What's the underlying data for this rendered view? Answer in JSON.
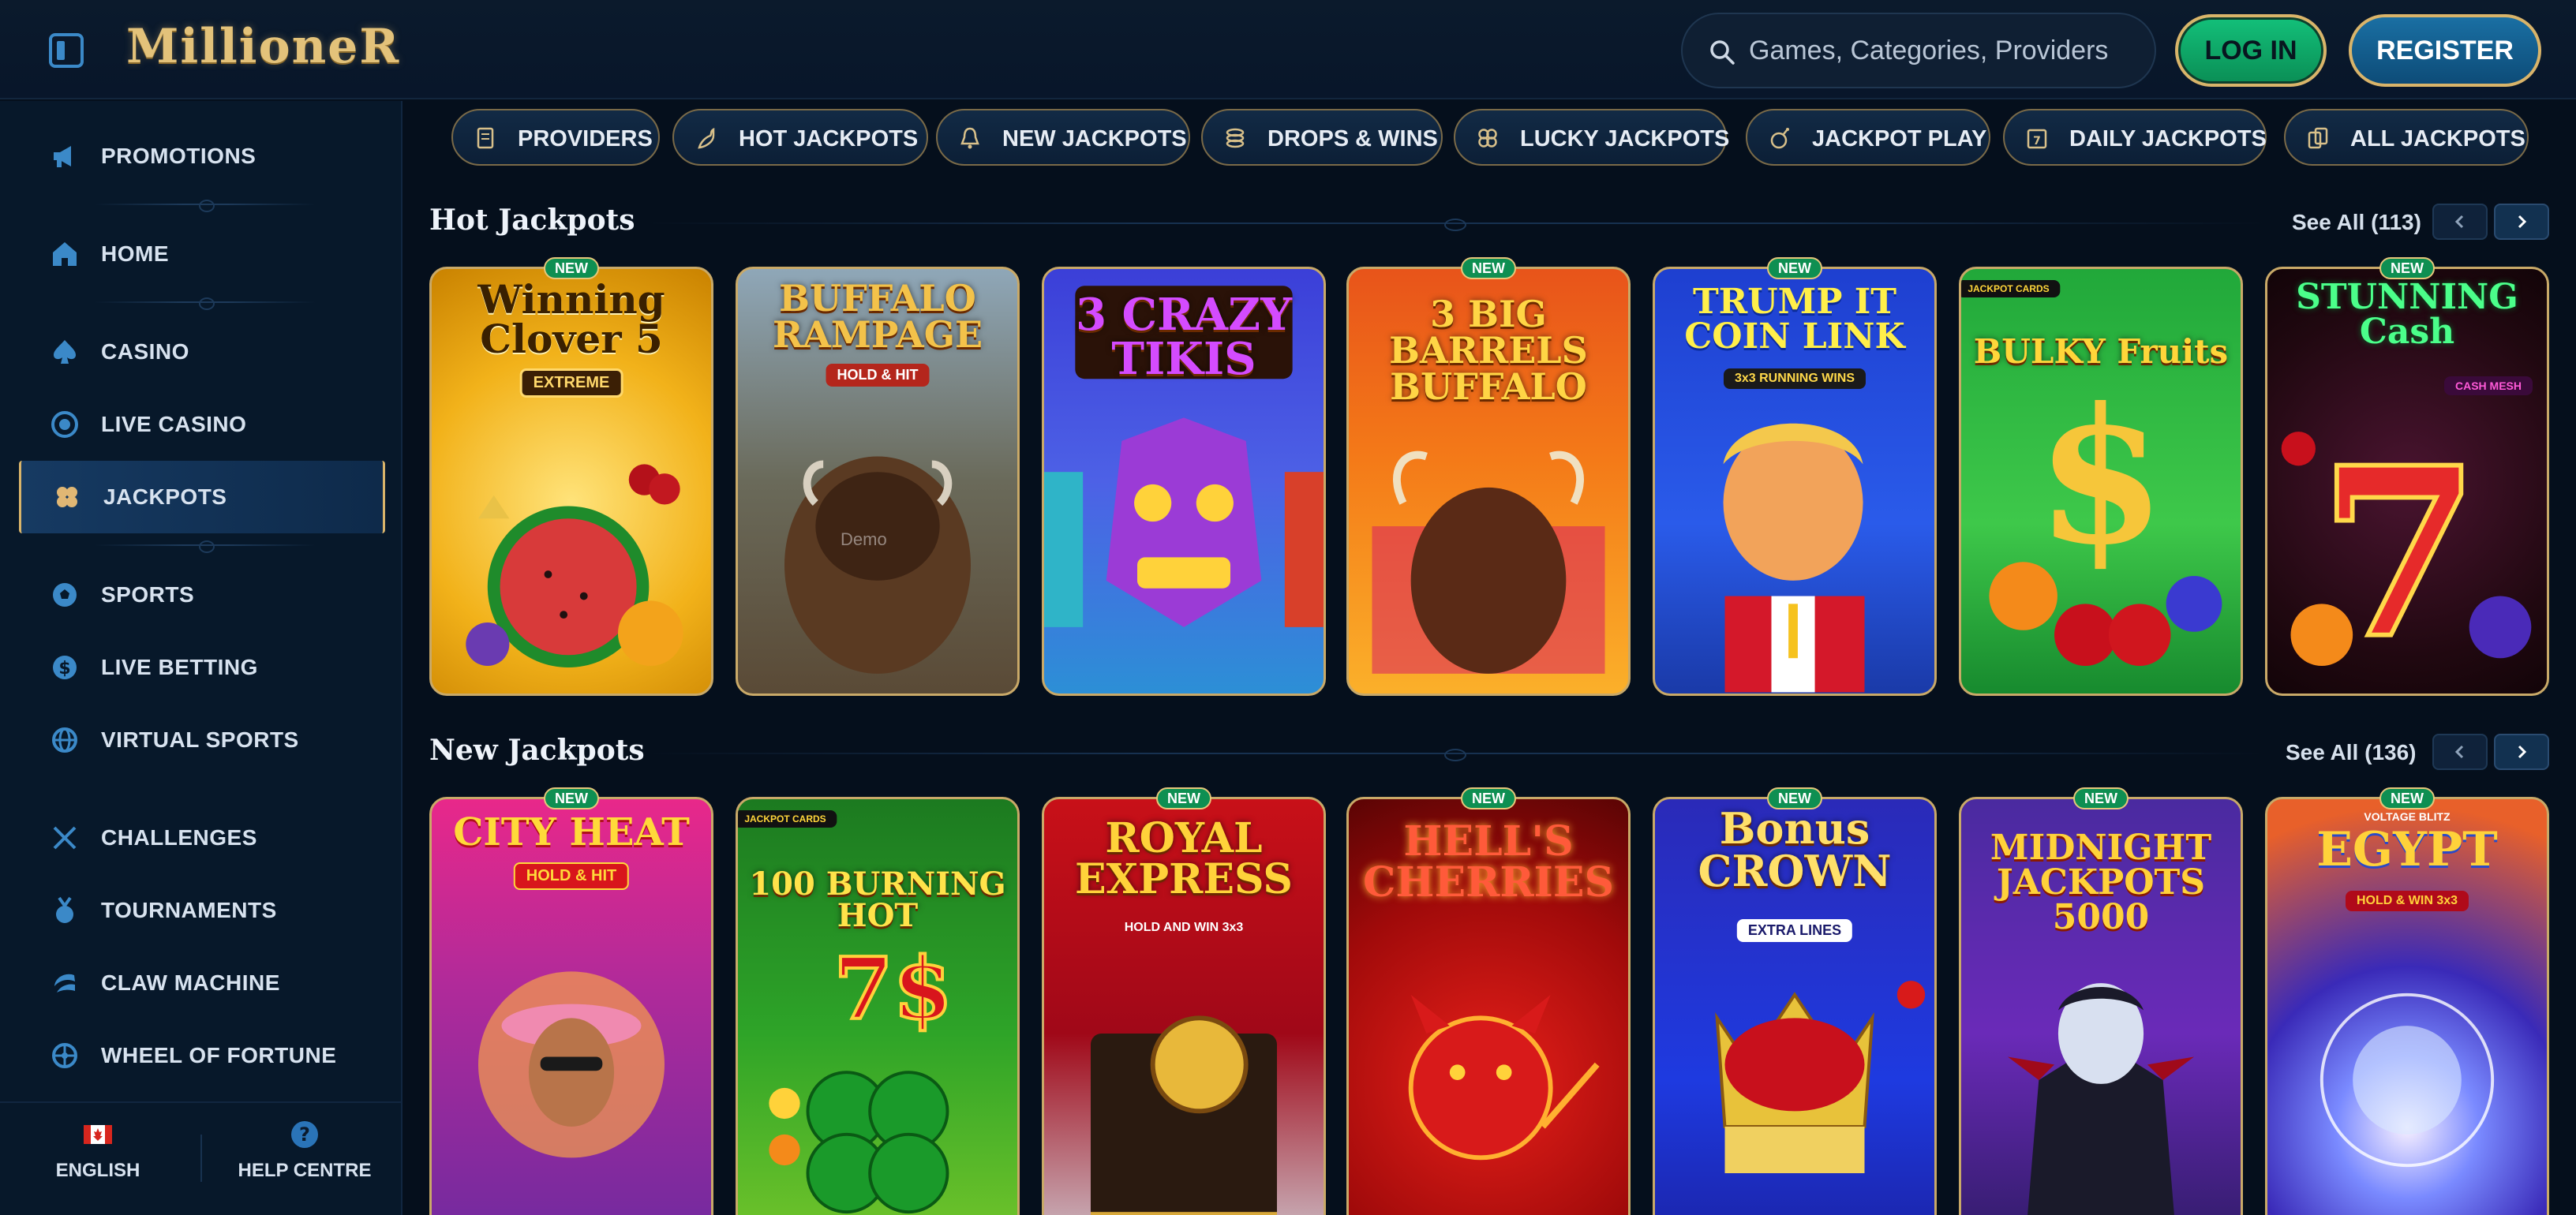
{
  "header": {
    "logo_text": "MillioneR",
    "search_placeholder": "Games, Categories, Providers",
    "login_label": "LOG IN",
    "register_label": "REGISTER"
  },
  "sidebar": {
    "items": [
      {
        "label": "PROMOTIONS",
        "icon": "megaphone-icon"
      },
      {
        "label": "HOME",
        "icon": "home-icon"
      },
      {
        "label": "CASINO",
        "icon": "spade-icon"
      },
      {
        "label": "LIVE CASINO",
        "icon": "chip-icon"
      },
      {
        "label": "JACKPOTS",
        "icon": "clover-icon",
        "active": true
      },
      {
        "label": "SPORTS",
        "icon": "soccer-ball-icon"
      },
      {
        "label": "LIVE BETTING",
        "icon": "dollar-coin-icon"
      },
      {
        "label": "VIRTUAL SPORTS",
        "icon": "globe-icon"
      },
      {
        "label": "CHALLENGES",
        "icon": "crossed-swords-icon"
      },
      {
        "label": "TOURNAMENTS",
        "icon": "medal-icon"
      },
      {
        "label": "CLAW MACHINE",
        "icon": "claw-icon"
      },
      {
        "label": "WHEEL OF FORTUNE",
        "icon": "wheel-icon"
      }
    ],
    "footer": {
      "language_label": "ENGLISH",
      "help_label": "HELP CENTRE"
    }
  },
  "categories": [
    {
      "label": "PROVIDERS",
      "icon": "document-icon"
    },
    {
      "label": "HOT JACKPOTS",
      "icon": "chili-icon"
    },
    {
      "label": "NEW JACKPOTS",
      "icon": "bell-icon"
    },
    {
      "label": "DROPS & WINS",
      "icon": "coins-icon"
    },
    {
      "label": "LUCKY JACKPOTS",
      "icon": "clover-icon"
    },
    {
      "label": "JACKPOT PLAY",
      "icon": "bomb-icon"
    },
    {
      "label": "DAILY JACKPOTS",
      "icon": "calendar-icon"
    },
    {
      "label": "ALL JACKPOTS",
      "icon": "cards-icon"
    }
  ],
  "sections": {
    "hot": {
      "title": "Hot Jackpots",
      "see_all": "See All (113)",
      "games": [
        {
          "title": "Winning Clover 5",
          "sub": "EXTREME",
          "new": true
        },
        {
          "title": "BUFFALO RAMPAGE",
          "sub": "HOLD & HIT",
          "new": false,
          "demo": "Demo"
        },
        {
          "title": "3 CRAZY TIKIS",
          "sub": "",
          "new": false
        },
        {
          "title": "3 BIG BARRELS BUFFALO",
          "sub": "",
          "new": true
        },
        {
          "title": "TRUMP IT COIN LINK",
          "sub": "3x3 RUNNING WINS",
          "new": true
        },
        {
          "title": "BULKY Fruits",
          "sub": "JACKPOT CARDS",
          "new": false
        },
        {
          "title": "STUNNING Cash",
          "sub": "CASH MESH",
          "new": true
        }
      ]
    },
    "new": {
      "title": "New Jackpots",
      "see_all": "See All (136)",
      "games": [
        {
          "title": "CITY HEAT",
          "sub": "HOLD & HIT",
          "new": true
        },
        {
          "title": "100 BURNING HOT",
          "sub": "JACKPOT CARDS",
          "new": false
        },
        {
          "title": "ROYAL EXPRESS",
          "sub": "HOLD AND WIN 3x3",
          "new": true
        },
        {
          "title": "HELL'S CHERRIES",
          "sub": "",
          "new": true
        },
        {
          "title": "Bonus CROWN",
          "sub": "EXTRA LINES",
          "new": true
        },
        {
          "title": "MIDNIGHT JACKPOTS 5000",
          "sub": "",
          "new": true
        },
        {
          "title": "EGYPT",
          "sub": "HOLD & WIN 3x3",
          "top": "VOLTAGE BLITZ",
          "new": true
        }
      ]
    }
  },
  "badge_new_label": "NEW",
  "colors": {
    "background": "#050f1c",
    "sidebar": "#07182a",
    "accent_gold": "#d9b46a",
    "login_green": "#13c07a",
    "register_blue": "#1a6fa3",
    "icon_blue": "#3b89c8"
  }
}
